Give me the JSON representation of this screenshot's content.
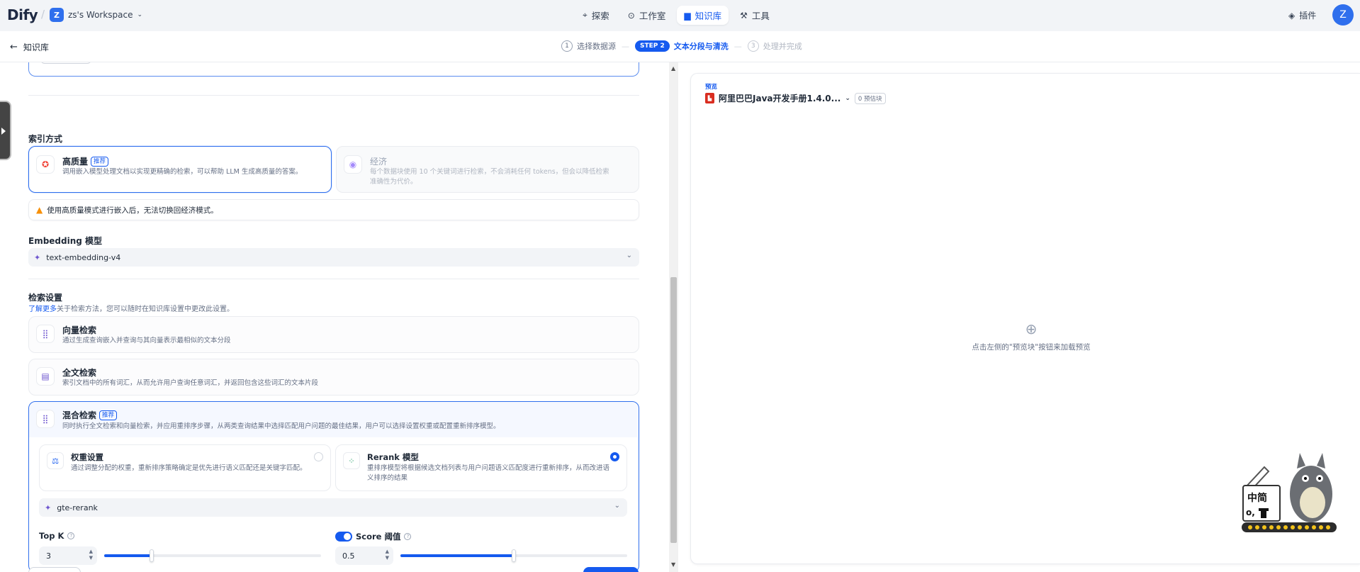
{
  "nav": {
    "logo": "Dify",
    "workspace_initial": "Z",
    "workspace_name": "zs's Workspace",
    "links": [
      {
        "label": "探索",
        "icon": "compass-icon"
      },
      {
        "label": "工作室",
        "icon": "studio-icon"
      },
      {
        "label": "知识库",
        "icon": "book-icon",
        "active": true
      },
      {
        "label": "工具",
        "icon": "tool-icon"
      }
    ],
    "plugins": "插件",
    "user_initial": "Z"
  },
  "subbar": {
    "back_label": "知识库",
    "steps": [
      {
        "num": "1",
        "label": "选择数据源"
      },
      {
        "pill": "STEP 2",
        "label": "文本分段与清洗"
      },
      {
        "num": "3",
        "label": "处理并完成"
      }
    ]
  },
  "index": {
    "title": "索引方式",
    "high_quality": {
      "title": "高质量",
      "badge": "推荐",
      "desc": "调用嵌入模型处理文档以实现更精确的检索，可以帮助 LLM 生成高质量的答案。"
    },
    "economy": {
      "title": "经济",
      "desc_line1": "每个数据块使用 10 个关键词进行检索，不会消耗任何 tokens，但会以降低检索",
      "desc_line2": "准确性为代价。"
    },
    "warning": "使用高质量模式进行嵌入后，无法切换回经济模式。"
  },
  "embedding": {
    "title": "Embedding 模型",
    "model": "text-embedding-v4"
  },
  "retrieval": {
    "title": "检索设置",
    "learn_more": "了解更多",
    "hint": "关于检索方法，您可以随时在知识库设置中更改此设置。",
    "vector": {
      "title": "向量检索",
      "desc": "通过生成查询嵌入并查询与其向量表示最相似的文本分段"
    },
    "fulltext": {
      "title": "全文检索",
      "desc": "索引文档中的所有词汇，从而允许用户查询任意词汇，并返回包含这些词汇的文本片段"
    },
    "hybrid": {
      "title": "混合检索",
      "badge": "推荐",
      "desc": "同时执行全文检索和向量检索，并应用重排序步骤，从两类查询结果中选择匹配用户问题的最佳结果，用户可以选择设置权重或配置重新排序模型。",
      "weight": {
        "title": "权重设置",
        "desc": "通过调整分配的权重，重新排序策略确定是优先进行语义匹配还是关键字匹配。"
      },
      "rerank": {
        "title": "Rerank 模型",
        "desc": "重排序模型将根据候选文档列表与用户问题语义匹配度进行重新排序，从而改进语义排序的结果"
      },
      "rerank_model": "gte-rerank",
      "top_k_label": "Top K",
      "top_k_value": "3",
      "top_k_fraction": 0.22,
      "score_label": "Score 阈值",
      "score_value": "0.5",
      "score_fraction": 0.5
    }
  },
  "preview": {
    "label": "预览",
    "doc_name": "阿里巴巴Java开发手册1.4.0...",
    "chunks": "0 预估块",
    "empty_hint": "点击左侧的\"预览块\"按钮来加载预览"
  },
  "mascot": {
    "text_top": "中简",
    "text_bottom": "o,"
  }
}
